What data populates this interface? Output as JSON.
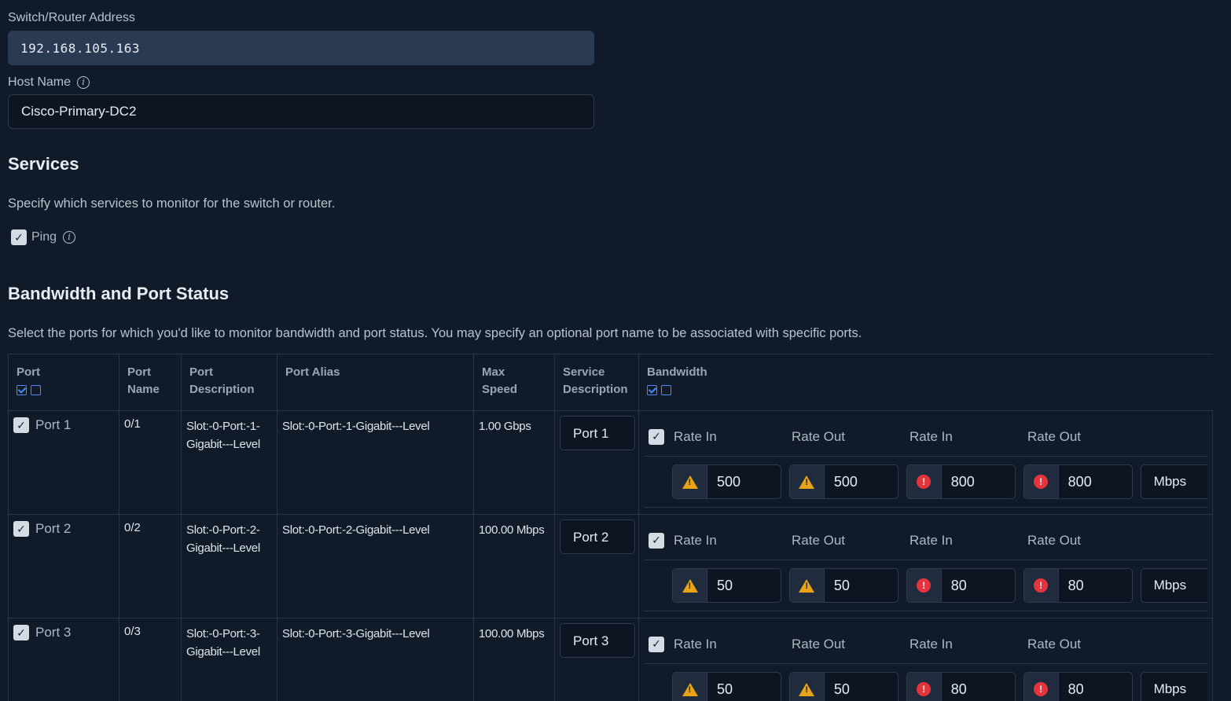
{
  "form": {
    "address_label": "Switch/Router Address",
    "address_value": "192.168.105.163",
    "host_label": "Host Name",
    "host_value": "Cisco-Primary-DC2"
  },
  "services": {
    "title": "Services",
    "description": "Specify which services to monitor for the switch or router.",
    "ping_label": "Ping",
    "ping_checked": true
  },
  "bandwidth": {
    "title": "Bandwidth and Port Status",
    "description": "Select the ports for which you'd like to monitor bandwidth and port status. You may specify an optional port name to be associated with specific ports.",
    "headers": {
      "port": "Port",
      "port_name_1": "Port",
      "port_name_2": "Name",
      "port_desc_1": "Port",
      "port_desc_2": "Description",
      "port_alias": "Port Alias",
      "max_speed_1": "Max",
      "max_speed_2": "Speed",
      "svc_desc_1": "Service",
      "svc_desc_2": "Description",
      "bandwidth": "Bandwidth"
    },
    "rate_labels": [
      "Rate In",
      "Rate Out",
      "Rate In",
      "Rate Out"
    ],
    "rows": [
      {
        "port": "Port 1",
        "name": "0/1",
        "desc_1": "Slot:-0-Port:-1-",
        "desc_2": "Gigabit---Level",
        "alias": "Slot:-0-Port:-1-Gigabit---Level",
        "speed": "1.00 Gbps",
        "service": "Port 1",
        "warn_in": "500",
        "warn_out": "500",
        "crit_in": "800",
        "crit_out": "800",
        "unit": "Mbps"
      },
      {
        "port": "Port 2",
        "name": "0/2",
        "desc_1": "Slot:-0-Port:-2-",
        "desc_2": "Gigabit---Level",
        "alias": "Slot:-0-Port:-2-Gigabit---Level",
        "speed": "100.00 Mbps",
        "service": "Port 2",
        "warn_in": "50",
        "warn_out": "50",
        "crit_in": "80",
        "crit_out": "80",
        "unit": "Mbps"
      },
      {
        "port": "Port 3",
        "name": "0/3",
        "desc_1": "Slot:-0-Port:-3-",
        "desc_2": "Gigabit---Level",
        "alias": "Slot:-0-Port:-3-Gigabit---Level",
        "speed": "100.00 Mbps",
        "service": "Port 3",
        "warn_in": "50",
        "warn_out": "50",
        "crit_in": "80",
        "crit_out": "80",
        "unit": "Mbps"
      }
    ]
  },
  "colors": {
    "background": "#111a28",
    "warning": "#e8a317",
    "critical": "#e5343d",
    "accent": "#4a8bff"
  },
  "icons": {
    "info": "info-icon",
    "warning": "warning-icon",
    "critical": "critical-icon",
    "check": "checkbox-icon"
  }
}
